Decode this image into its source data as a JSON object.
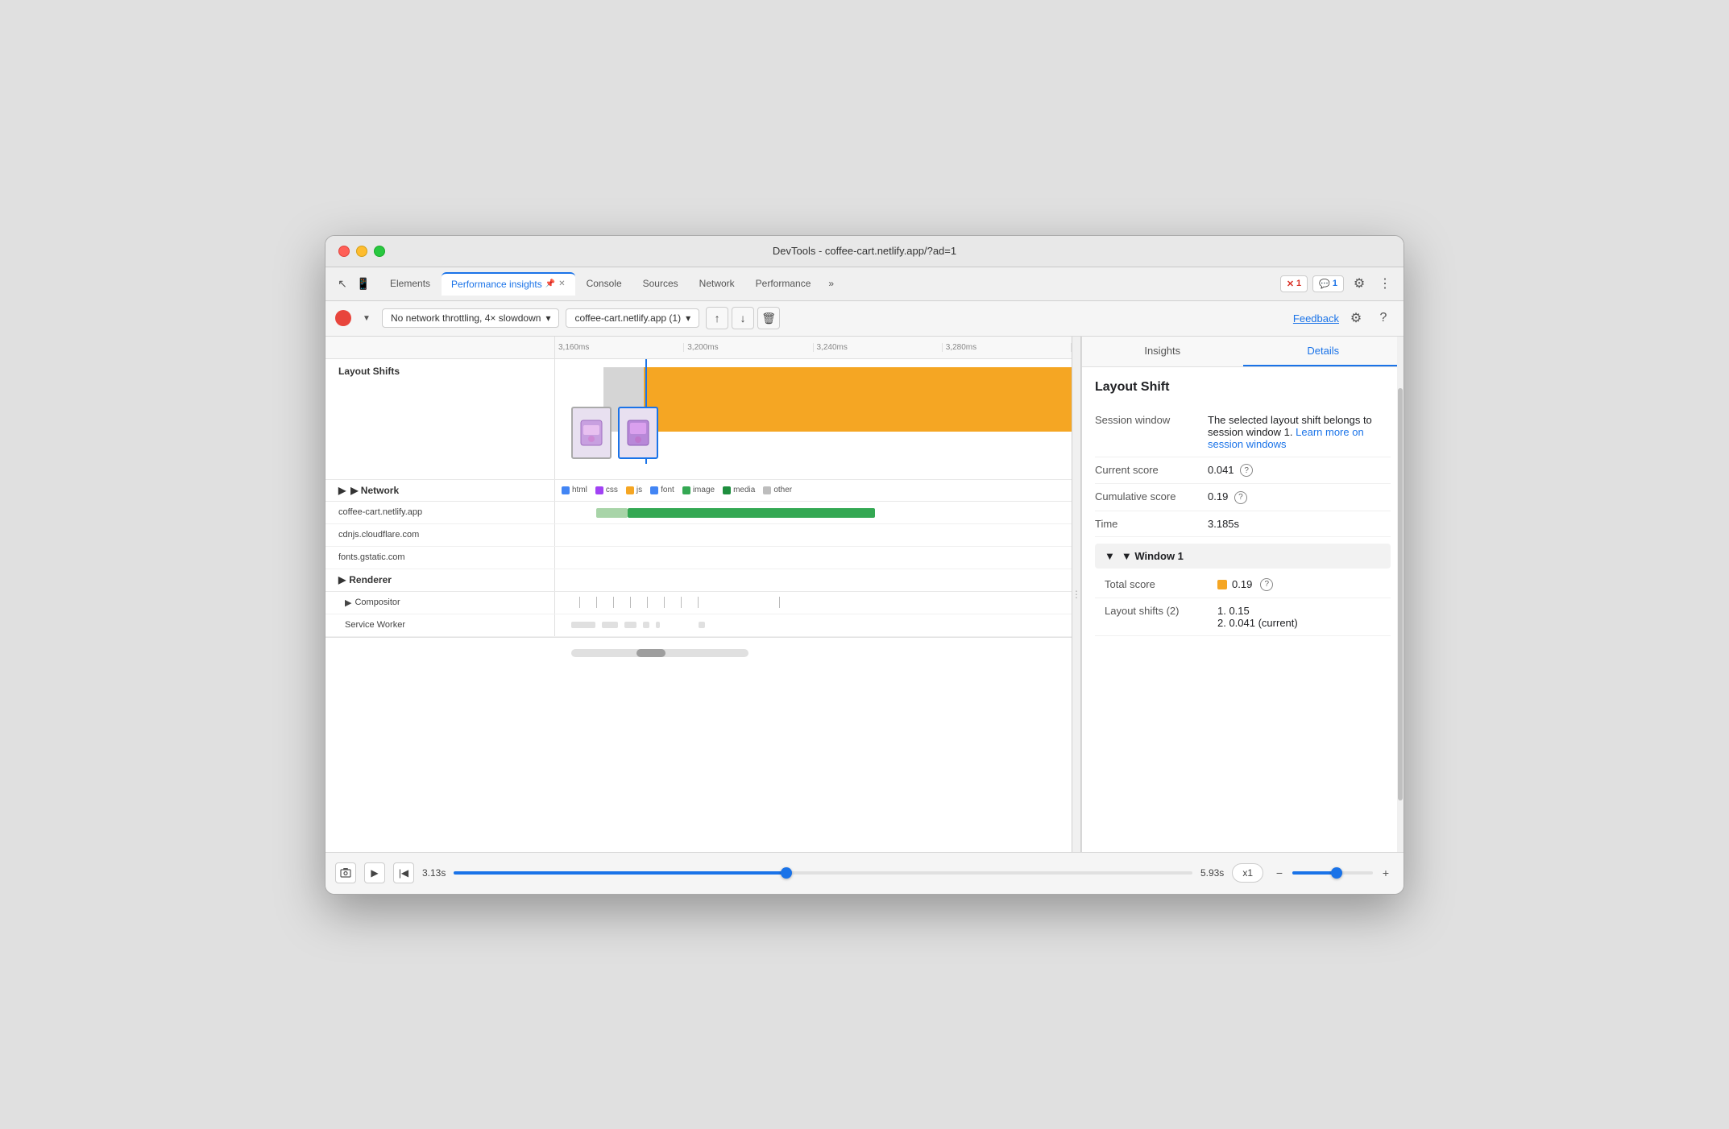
{
  "window": {
    "title": "DevTools - coffee-cart.netlify.app/?ad=1"
  },
  "tabs": {
    "items": [
      {
        "id": "elements",
        "label": "Elements",
        "active": false
      },
      {
        "id": "performance-insights",
        "label": "Performance insights",
        "active": true,
        "pinned": true
      },
      {
        "id": "console",
        "label": "Console",
        "active": false
      },
      {
        "id": "sources",
        "label": "Sources",
        "active": false
      },
      {
        "id": "network",
        "label": "Network",
        "active": false
      },
      {
        "id": "performance",
        "label": "Performance",
        "active": false
      }
    ],
    "more_label": "»",
    "error_badge": "1",
    "message_badge": "1"
  },
  "toolbar": {
    "throttle_label": "No network throttling, 4× slowdown",
    "url_label": "coffee-cart.netlify.app (1)",
    "feedback_label": "Feedback",
    "actions": {
      "upload": "↑",
      "download": "↓",
      "delete": "🗑"
    }
  },
  "ruler": {
    "ticks": [
      "3,160ms",
      "3,200ms",
      "3,240ms",
      "3,280ms"
    ]
  },
  "sections": {
    "layout_shifts": {
      "label": "Layout Shifts"
    },
    "network": {
      "label": "▶ Network",
      "legend": [
        {
          "color": "#4285f4",
          "label": "html"
        },
        {
          "color": "#a142f4",
          "label": "css"
        },
        {
          "color": "#f5a623",
          "label": "js"
        },
        {
          "color": "#4285f4",
          "label": "font"
        },
        {
          "color": "#34a853",
          "label": "image"
        },
        {
          "color": "#1e8e3e",
          "label": "media"
        },
        {
          "color": "#bdbdbd",
          "label": "other"
        }
      ],
      "rows": [
        {
          "label": "coffee-cart.netlify.app",
          "bar_left": "12%",
          "bar_width": "55%",
          "bar_color": "#34a853"
        },
        {
          "label": "cdnjs.cloudflare.com",
          "bar_left": "0",
          "bar_width": "0",
          "bar_color": ""
        },
        {
          "label": "fonts.gstatic.com",
          "bar_left": "0",
          "bar_width": "0",
          "bar_color": ""
        }
      ]
    },
    "renderer": {
      "label": "▶ Renderer",
      "compositor_label": "▶ Compositor",
      "service_worker_label": "Service Worker"
    }
  },
  "right_panel": {
    "tabs": [
      "Insights",
      "Details"
    ],
    "active_tab": "Details",
    "section_title": "Layout Shift",
    "details": [
      {
        "label": "Session window",
        "value": "The selected layout shift belongs to session window 1.",
        "link_text": "Learn more on session windows",
        "link_url": "#"
      },
      {
        "label": "Current score",
        "value": "0.041",
        "help": true
      },
      {
        "label": "Cumulative score",
        "value": "0.19",
        "help": true
      },
      {
        "label": "Time",
        "value": "3.185s"
      }
    ],
    "window_section": {
      "title": "▼ Window 1",
      "total_score_label": "Total score",
      "total_score_value": "0.19",
      "layout_shifts_label": "Layout shifts (2)",
      "layout_shifts_items": [
        "1. 0.15",
        "2. 0.041 (current)"
      ]
    }
  },
  "playback": {
    "start_time": "3.13s",
    "end_time": "5.93s",
    "speed_label": "x1",
    "zoom_in": "+",
    "zoom_out": "−"
  }
}
